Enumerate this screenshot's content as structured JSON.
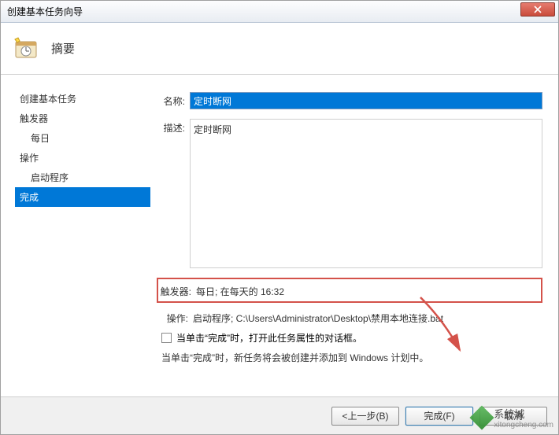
{
  "dialog": {
    "title": "创建基本任务向导"
  },
  "header": {
    "title": "摘要"
  },
  "sidebar": {
    "items": [
      {
        "label": "创建基本任务"
      },
      {
        "label": "触发器"
      },
      {
        "label": "每日"
      },
      {
        "label": "操作"
      },
      {
        "label": "启动程序"
      },
      {
        "label": "完成"
      }
    ]
  },
  "form": {
    "name_label": "名称:",
    "name_value": "定时断网",
    "desc_label": "描述:",
    "desc_value": "定时断网",
    "trigger_label": "触发器:",
    "trigger_value": "每日; 在每天的 16:32",
    "action_label": "操作:",
    "action_value": "启动程序; C:\\Users\\Administrator\\Desktop\\禁用本地连接.bat",
    "checkbox_label": "当单击“完成”时，打开此任务属性的对话框。",
    "info_text": "当单击“完成”时，新任务将会被创建并添加到 Windows 计划中。"
  },
  "footer": {
    "back": "<上一步(B)",
    "finish": "完成(F)",
    "cancel": "取消"
  },
  "watermark": {
    "brand": "系统城",
    "url": "xitongcheng.com"
  }
}
